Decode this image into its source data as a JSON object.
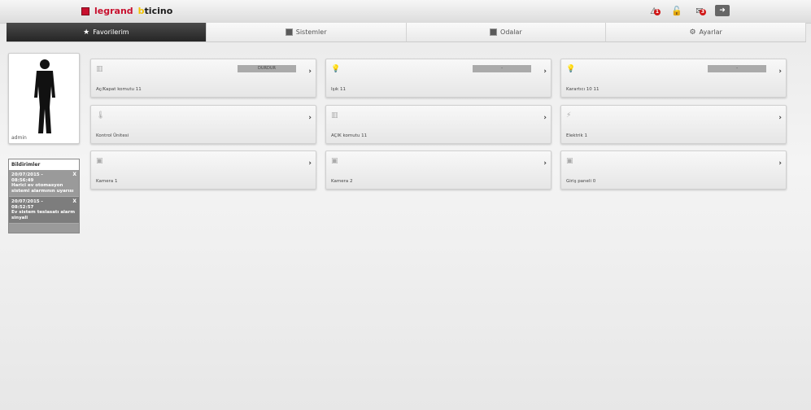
{
  "brand": {
    "legrand": "legrand",
    "bticino_b": "b",
    "bticino_rest": "ticino"
  },
  "header_icons": [
    {
      "name": "alarm-icon",
      "glyph": "⚠",
      "badge": "1"
    },
    {
      "name": "lock-icon",
      "glyph": "🔓",
      "badge": ""
    },
    {
      "name": "mail-icon",
      "glyph": "✉",
      "badge": "3"
    }
  ],
  "tabs": [
    {
      "label": "Favorilerim",
      "active": true
    },
    {
      "label": "Sistemler",
      "active": false
    },
    {
      "label": "Odalar",
      "active": false
    },
    {
      "label": "Ayarlar",
      "active": false
    }
  ],
  "user": {
    "name": "admin"
  },
  "notifications": {
    "title": "Bildirimler",
    "items": [
      {
        "date": "20/07/2015 -",
        "time": "08:56:49",
        "text": "Harici ev otomasyon sistemi alarmının uyarısı",
        "close": "X"
      },
      {
        "date": "20/07/2015 -",
        "time": "08:52:57",
        "text": "Ev sistem teslasatı alarm sinyali",
        "close": "X"
      }
    ]
  },
  "tiles": [
    {
      "label": "Aç/Kapat komutu 11",
      "icon": "▥",
      "button": "DURDUR",
      "arrow": "›"
    },
    {
      "label": "Işık 11",
      "icon": "💡",
      "button": "-",
      "arrow": "›"
    },
    {
      "label": "Karartıcı 10 11",
      "icon": "💡",
      "button": "-",
      "arrow": "›"
    },
    {
      "label": "Kontrol Ünitesi",
      "icon": "🌡",
      "button": "",
      "arrow": "›"
    },
    {
      "label": "AÇIK komutu 11",
      "icon": "▥",
      "button": "",
      "arrow": "›"
    },
    {
      "label": "Elektrik 1",
      "icon": "⚡",
      "button": "",
      "arrow": "›"
    },
    {
      "label": "Kamera 1",
      "icon": "▣",
      "button": "",
      "arrow": "›"
    },
    {
      "label": "Kamera 2",
      "icon": "▣",
      "button": "",
      "arrow": "›"
    },
    {
      "label": "Giriş paneli 0",
      "icon": "▣",
      "button": "",
      "arrow": "›"
    }
  ]
}
